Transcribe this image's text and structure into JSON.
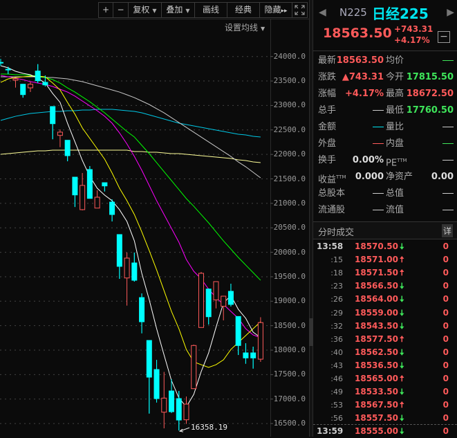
{
  "toolbar": {
    "plus": "+",
    "minus": "−",
    "fuquan": "复权",
    "overlay": "叠加",
    "draw": "画线",
    "classic": "经典",
    "hide": "隐藏",
    "hide_arrows": "▸▸",
    "fullscreen_icon": "fullscreen-icon"
  },
  "ma_settings": "设置均线",
  "colors": {
    "up": "#ff5a5a",
    "down": "#00ffff",
    "ma5": "#ffffff",
    "ma10": "#ffff00",
    "ma20": "#ff00ff",
    "ma30": "#00ff00",
    "ma60": "#c8c8c8",
    "ma120": "#00c8e6",
    "ma250": "#ffff99"
  },
  "chart_data": {
    "type": "candlestick",
    "y_ticks": [
      "24000.0",
      "23500.0",
      "23000.0",
      "22500.0",
      "22000.0",
      "21500.0",
      "21000.0",
      "20500.0",
      "20000.0",
      "19500.0",
      "19000.0",
      "18500.0",
      "18000.0",
      "17500.0",
      "17000.0",
      "16500.0"
    ],
    "ylim": [
      16500,
      24000
    ],
    "low_annotation": "16358.19",
    "candles": [
      [
        23880,
        23950,
        23810,
        23870
      ],
      [
        23740,
        23790,
        23640,
        23730
      ],
      [
        23515,
        23560,
        23365,
        23545
      ],
      [
        23434,
        23440,
        23160,
        23222
      ],
      [
        23360,
        23480,
        23275,
        23434
      ],
      [
        23703,
        23844,
        23458,
        23505
      ],
      [
        23473,
        23614,
        23388,
        23420
      ],
      [
        22978,
        22978,
        22310,
        22628
      ],
      [
        22388,
        22510,
        22148,
        22455
      ],
      [
        22289,
        22289,
        21860,
        21974
      ],
      [
        21535,
        21535,
        20926,
        21172
      ],
      [
        20871,
        21620,
        20857,
        21366
      ],
      [
        21691,
        21762,
        21101,
        21101
      ],
      [
        20903,
        21266,
        20903,
        21125
      ],
      [
        21422,
        21422,
        21243,
        21356
      ],
      [
        21025,
        21081,
        20630,
        20772
      ],
      [
        20362,
        20362,
        19458,
        19712
      ],
      [
        19475,
        19994,
        18910,
        19881
      ],
      [
        19782,
        19994,
        19400,
        19428
      ],
      [
        19074,
        19160,
        18344,
        18580
      ],
      [
        18198,
        18198,
        16704,
        17448
      ],
      [
        17604,
        17802,
        16930,
        17010
      ],
      [
        16732,
        17555,
        16402,
        17020
      ],
      [
        17166,
        17406,
        16714,
        16742
      ],
      [
        17010,
        17166,
        16358.19,
        16572
      ],
      [
        16577,
        17053,
        16492,
        16897
      ],
      [
        17213,
        18113,
        17213,
        18095
      ],
      [
        18463,
        19598,
        18463,
        19570
      ],
      [
        19249,
        19260,
        18523,
        18683
      ],
      [
        19028,
        19400,
        18853,
        19400
      ],
      [
        18896,
        19103,
        18608,
        19103
      ],
      [
        19202,
        19358,
        18891,
        18934
      ],
      [
        18688,
        18688,
        17901,
        18095
      ],
      [
        17944,
        18142,
        17722,
        17841
      ],
      [
        17944,
        18071,
        17623,
        17841
      ],
      [
        17815.5,
        18672.5,
        17760.5,
        18563.5
      ]
    ],
    "ma": {
      "ma5": [
        23812,
        23770,
        23699,
        23656,
        23628,
        23557,
        23458,
        23246,
        23063,
        22638,
        22256,
        21875,
        21550,
        21309,
        21168,
        21054,
        20870,
        20630,
        20234,
        19570,
        19032,
        18438,
        17901,
        17378,
        17024,
        16840,
        17095,
        17561,
        17943,
        18466,
        18962,
        19117,
        18834,
        18651,
        18368,
        18255
      ],
      "ma10": [
        23472,
        23543,
        23571,
        23586,
        23600,
        23600,
        23586,
        23458,
        23317,
        23063,
        22822,
        22539,
        22327,
        22115,
        21903,
        21620,
        21309,
        21054,
        20772,
        20418,
        20036,
        19640,
        19216,
        18792,
        18438,
        18014,
        17760,
        17703,
        17647,
        17703,
        17802,
        18014,
        18156,
        18297,
        18438,
        18580
      ],
      "ma20": [
        23613,
        23586,
        23557,
        23528,
        23486,
        23458,
        23430,
        23388,
        23331,
        23274,
        23190,
        23091,
        22992,
        22893,
        22780,
        22638,
        22440,
        22214,
        21960,
        21677,
        21366,
        21054,
        20772,
        20489,
        20206,
        19853,
        19612,
        19457,
        19245,
        19075,
        18934,
        18792,
        18651,
        18438,
        18311,
        18255
      ],
      "ma30": [
        23642,
        23642,
        23628,
        23628,
        23614,
        23600,
        23572,
        23529,
        23458,
        23359,
        23274,
        23175,
        23076,
        22964,
        22851,
        22723,
        22596,
        22469,
        22356,
        22186,
        22016,
        21832,
        21648,
        21465,
        21281,
        21097,
        20941,
        20771,
        20602,
        20418,
        20234,
        20065,
        19895,
        19739,
        19584,
        19428
      ],
      "ma60": [
        23586,
        23586,
        23586,
        23586,
        23586,
        23586,
        23572,
        23572,
        23557,
        23543,
        23515,
        23487,
        23444,
        23402,
        23359,
        23317,
        23274,
        23218,
        23161,
        23091,
        23020,
        22935,
        22850,
        22751,
        22652,
        22553,
        22454,
        22355,
        22256,
        22157,
        22058,
        21959,
        21846,
        21747,
        21634,
        21521
      ],
      "ma120": [
        22695,
        22737,
        22779,
        22808,
        22836,
        22850,
        22864,
        22878,
        22878,
        22893,
        22893,
        22907,
        22907,
        22921,
        22921,
        22921,
        22907,
        22893,
        22878,
        22850,
        22808,
        22765,
        22723,
        22681,
        22638,
        22610,
        22582,
        22553,
        22525,
        22497,
        22469,
        22440,
        22412,
        22398,
        22370,
        22356
      ],
      "ma250": [
        22002,
        22016,
        22030,
        22044,
        22058,
        22073,
        22073,
        22087,
        22087,
        22087,
        22087,
        22087,
        22087,
        22087,
        22087,
        22087,
        22087,
        22087,
        22058,
        22058,
        22044,
        22044,
        22030,
        22016,
        22016,
        22002,
        21988,
        21974,
        21959,
        21945,
        21931,
        21917,
        21889,
        21875,
        21846,
        21832
      ]
    }
  },
  "quote": {
    "code": "N225",
    "name": "日经225",
    "price": "18563.50",
    "change": "+743.31",
    "change_pct": "+4.17%"
  },
  "stats": [
    {
      "l": "最新",
      "v": "18563.50",
      "c": "red",
      "l2": "均价",
      "v2": "—",
      "c2": "green"
    },
    {
      "l": "涨跌",
      "v": "▲743.31",
      "c": "red",
      "l2": "今开",
      "v2": "17815.50",
      "c2": "green"
    },
    {
      "l": "涨幅",
      "v": "+4.17%",
      "c": "red",
      "l2": "最高",
      "v2": "18672.50",
      "c2": "red"
    },
    {
      "l": "总手",
      "v": "—",
      "c": "white",
      "l2": "最低",
      "v2": "17760.50",
      "c2": "green"
    },
    {
      "l": "金额",
      "v": "—",
      "c": "cyan",
      "l2": "量比",
      "v2": "—",
      "c2": "white"
    },
    {
      "l": "外盘",
      "v": "—",
      "c": "red",
      "l2": "内盘",
      "v2": "—",
      "c2": "green"
    },
    {
      "l": "换手",
      "v": "0.00%",
      "c": "white",
      "l2": "PE",
      "sup2": "TTM",
      "v2": "—",
      "c2": "white"
    },
    {
      "l": "收益",
      "sup": "TTM",
      "v": "0.000",
      "c": "white",
      "l2": "净资产",
      "v2": "0.00",
      "c2": "white"
    },
    {
      "l": "总股本",
      "v": "—",
      "c": "white",
      "l2": "总值",
      "v2": "—",
      "c2": "white"
    },
    {
      "l": "流通股",
      "v": "—",
      "c": "white",
      "l2": "流值",
      "v2": "—",
      "c2": "white"
    }
  ],
  "ticks": {
    "title": "分时成交",
    "detail": "详",
    "rows": [
      {
        "t": "13:58",
        "p": "18570.50",
        "d": "down",
        "v": "0"
      },
      {
        "t": ":15",
        "p": "18571.00",
        "d": "up",
        "v": "0"
      },
      {
        "t": ":18",
        "p": "18571.50",
        "d": "up",
        "v": "0"
      },
      {
        "t": ":23",
        "p": "18566.50",
        "d": "down",
        "v": "0"
      },
      {
        "t": ":26",
        "p": "18564.00",
        "d": "down",
        "v": "0"
      },
      {
        "t": ":29",
        "p": "18559.00",
        "d": "down",
        "v": "0"
      },
      {
        "t": ":32",
        "p": "18543.50",
        "d": "down",
        "v": "0"
      },
      {
        "t": ":36",
        "p": "18577.50",
        "d": "up",
        "v": "0"
      },
      {
        "t": ":40",
        "p": "18562.50",
        "d": "down",
        "v": "0"
      },
      {
        "t": ":43",
        "p": "18536.50",
        "d": "down",
        "v": "0"
      },
      {
        "t": ":46",
        "p": "18565.00",
        "d": "up",
        "v": "0"
      },
      {
        "t": ":49",
        "p": "18533.50",
        "d": "down",
        "v": "0"
      },
      {
        "t": ":53",
        "p": "18567.50",
        "d": "up",
        "v": "0"
      },
      {
        "t": ":56",
        "p": "18557.50",
        "d": "down",
        "v": "0"
      },
      {
        "t": "13:59",
        "p": "18555.00",
        "d": "down",
        "v": "0"
      }
    ]
  }
}
